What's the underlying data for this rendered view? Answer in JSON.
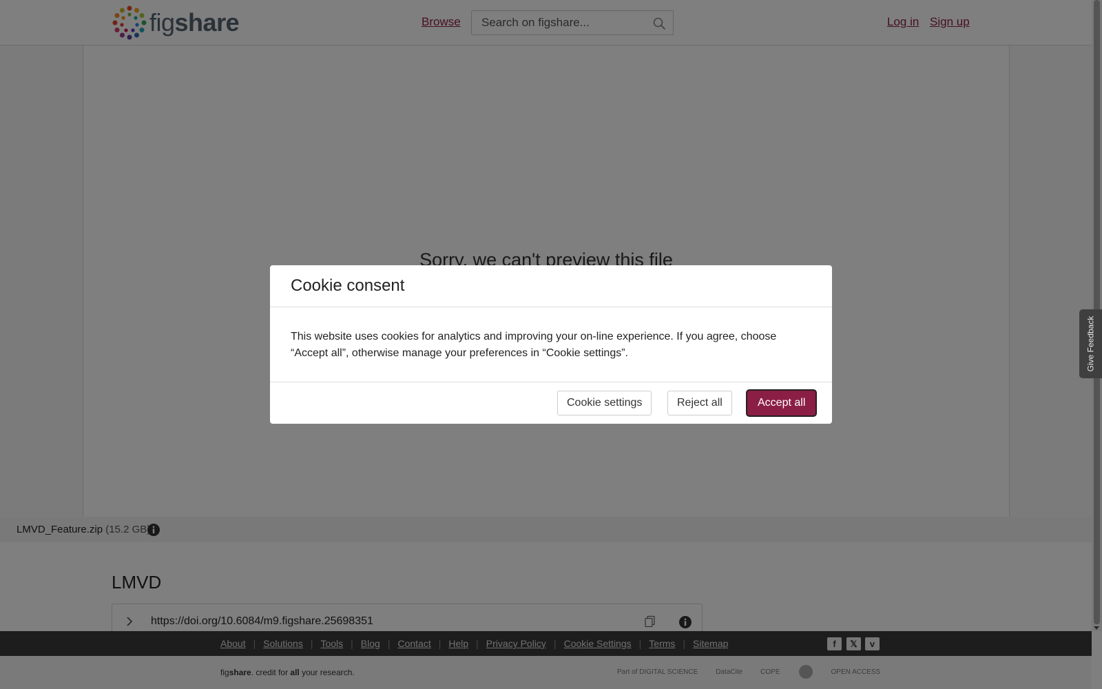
{
  "header": {
    "logo": {
      "text_light": "fig",
      "text_bold": "share"
    },
    "nav_browse": "Browse",
    "search": {
      "placeholder": "Search on figshare...",
      "value": ""
    },
    "login": "Log in",
    "signup": "Sign up"
  },
  "preview": {
    "message": "Sorry, we can't preview this file"
  },
  "file": {
    "name": "LMVD_Feature.zip",
    "size": "(15.2 GB)"
  },
  "article": {
    "title": "LMVD",
    "doi": "https://doi.org/10.6084/m9.figshare.25698351"
  },
  "footer": {
    "links": [
      "About",
      "Solutions",
      "Tools",
      "Blog",
      "Contact",
      "Help",
      "Privacy Policy",
      "Cookie Settings",
      "Terms",
      "Sitemap"
    ],
    "social": {
      "facebook": "f",
      "x": "𝕏",
      "vimeo": "v"
    },
    "tagline": {
      "brand_light": "fig",
      "brand_bold": "share",
      "text1": ". credit for ",
      "text_bold": "all",
      "text2": " your research."
    },
    "partners": [
      "Part of DIGITAL SCIENCE",
      "DataCite",
      "COPE",
      "OPEN ACCESS"
    ]
  },
  "feedback": {
    "label": "Give Feedback"
  },
  "cookie_modal": {
    "title": "Cookie consent",
    "body": "This website uses cookies for analytics and improving your on-line experience. If you agree, choose “Accept all”, otherwise manage your preferences in “Cookie settings”.",
    "buttons": {
      "settings": "Cookie settings",
      "reject": "Reject all",
      "accept": "Accept all"
    }
  },
  "colors": {
    "brand": "#8b1e45",
    "footer_dark": "#3a3a3a",
    "overlay": "rgba(0,0,0,0.5)"
  }
}
